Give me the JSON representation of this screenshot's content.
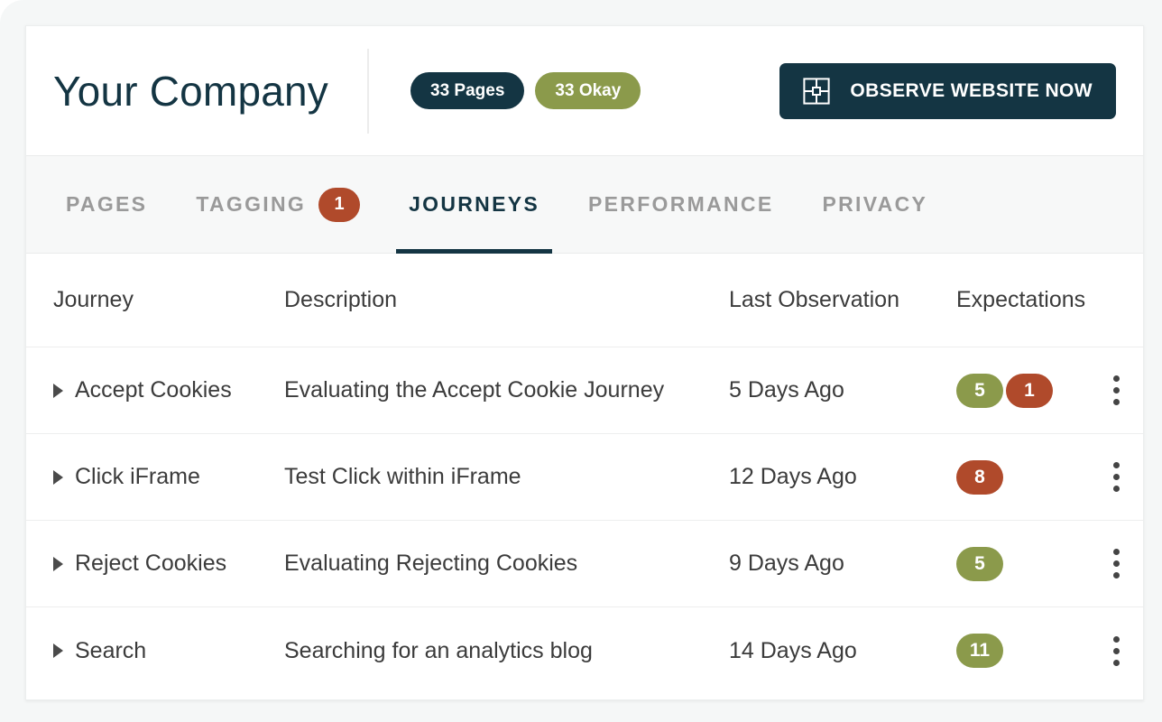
{
  "header": {
    "company_title": "Your Company",
    "pills": [
      {
        "label": "33 Pages",
        "style": "dark",
        "color": "#143543"
      },
      {
        "label": "33 Okay",
        "style": "olive",
        "color": "#8b9a4b"
      }
    ],
    "observe_button": {
      "label": "OBSERVE WEBSITE NOW",
      "icon": "grid-square-icon",
      "color": "#143543"
    }
  },
  "tabs": [
    {
      "label": "PAGES",
      "active": false,
      "count": null
    },
    {
      "label": "TAGGING",
      "active": false,
      "count": "1"
    },
    {
      "label": "JOURNEYS",
      "active": true,
      "count": null
    },
    {
      "label": "PERFORMANCE",
      "active": false,
      "count": null
    },
    {
      "label": "PRIVACY",
      "active": false,
      "count": null
    }
  ],
  "table": {
    "columns": [
      "Journey",
      "Description",
      "Last Observation",
      "Expectations"
    ],
    "rows": [
      {
        "journey": "Accept Cookies",
        "description": "Evaluating the Accept Cookie Journey",
        "last_observation": "5 Days Ago",
        "expectations": [
          {
            "value": "5",
            "status": "okay",
            "color": "#8b9a4b"
          },
          {
            "value": "1",
            "status": "failed",
            "color": "#b04a2b"
          }
        ]
      },
      {
        "journey": "Click iFrame",
        "description": "Test Click within iFrame",
        "last_observation": "12 Days Ago",
        "expectations": [
          {
            "value": "8",
            "status": "failed",
            "color": "#b04a2b"
          }
        ]
      },
      {
        "journey": "Reject Cookies",
        "description": "Evaluating Rejecting Cookies",
        "last_observation": "9 Days Ago",
        "expectations": [
          {
            "value": "5",
            "status": "okay",
            "color": "#8b9a4b"
          }
        ]
      },
      {
        "journey": "Search",
        "description": "Searching for an analytics blog",
        "last_observation": "14 Days Ago",
        "expectations": [
          {
            "value": "11",
            "status": "okay",
            "color": "#8b9a4b"
          }
        ]
      }
    ]
  }
}
